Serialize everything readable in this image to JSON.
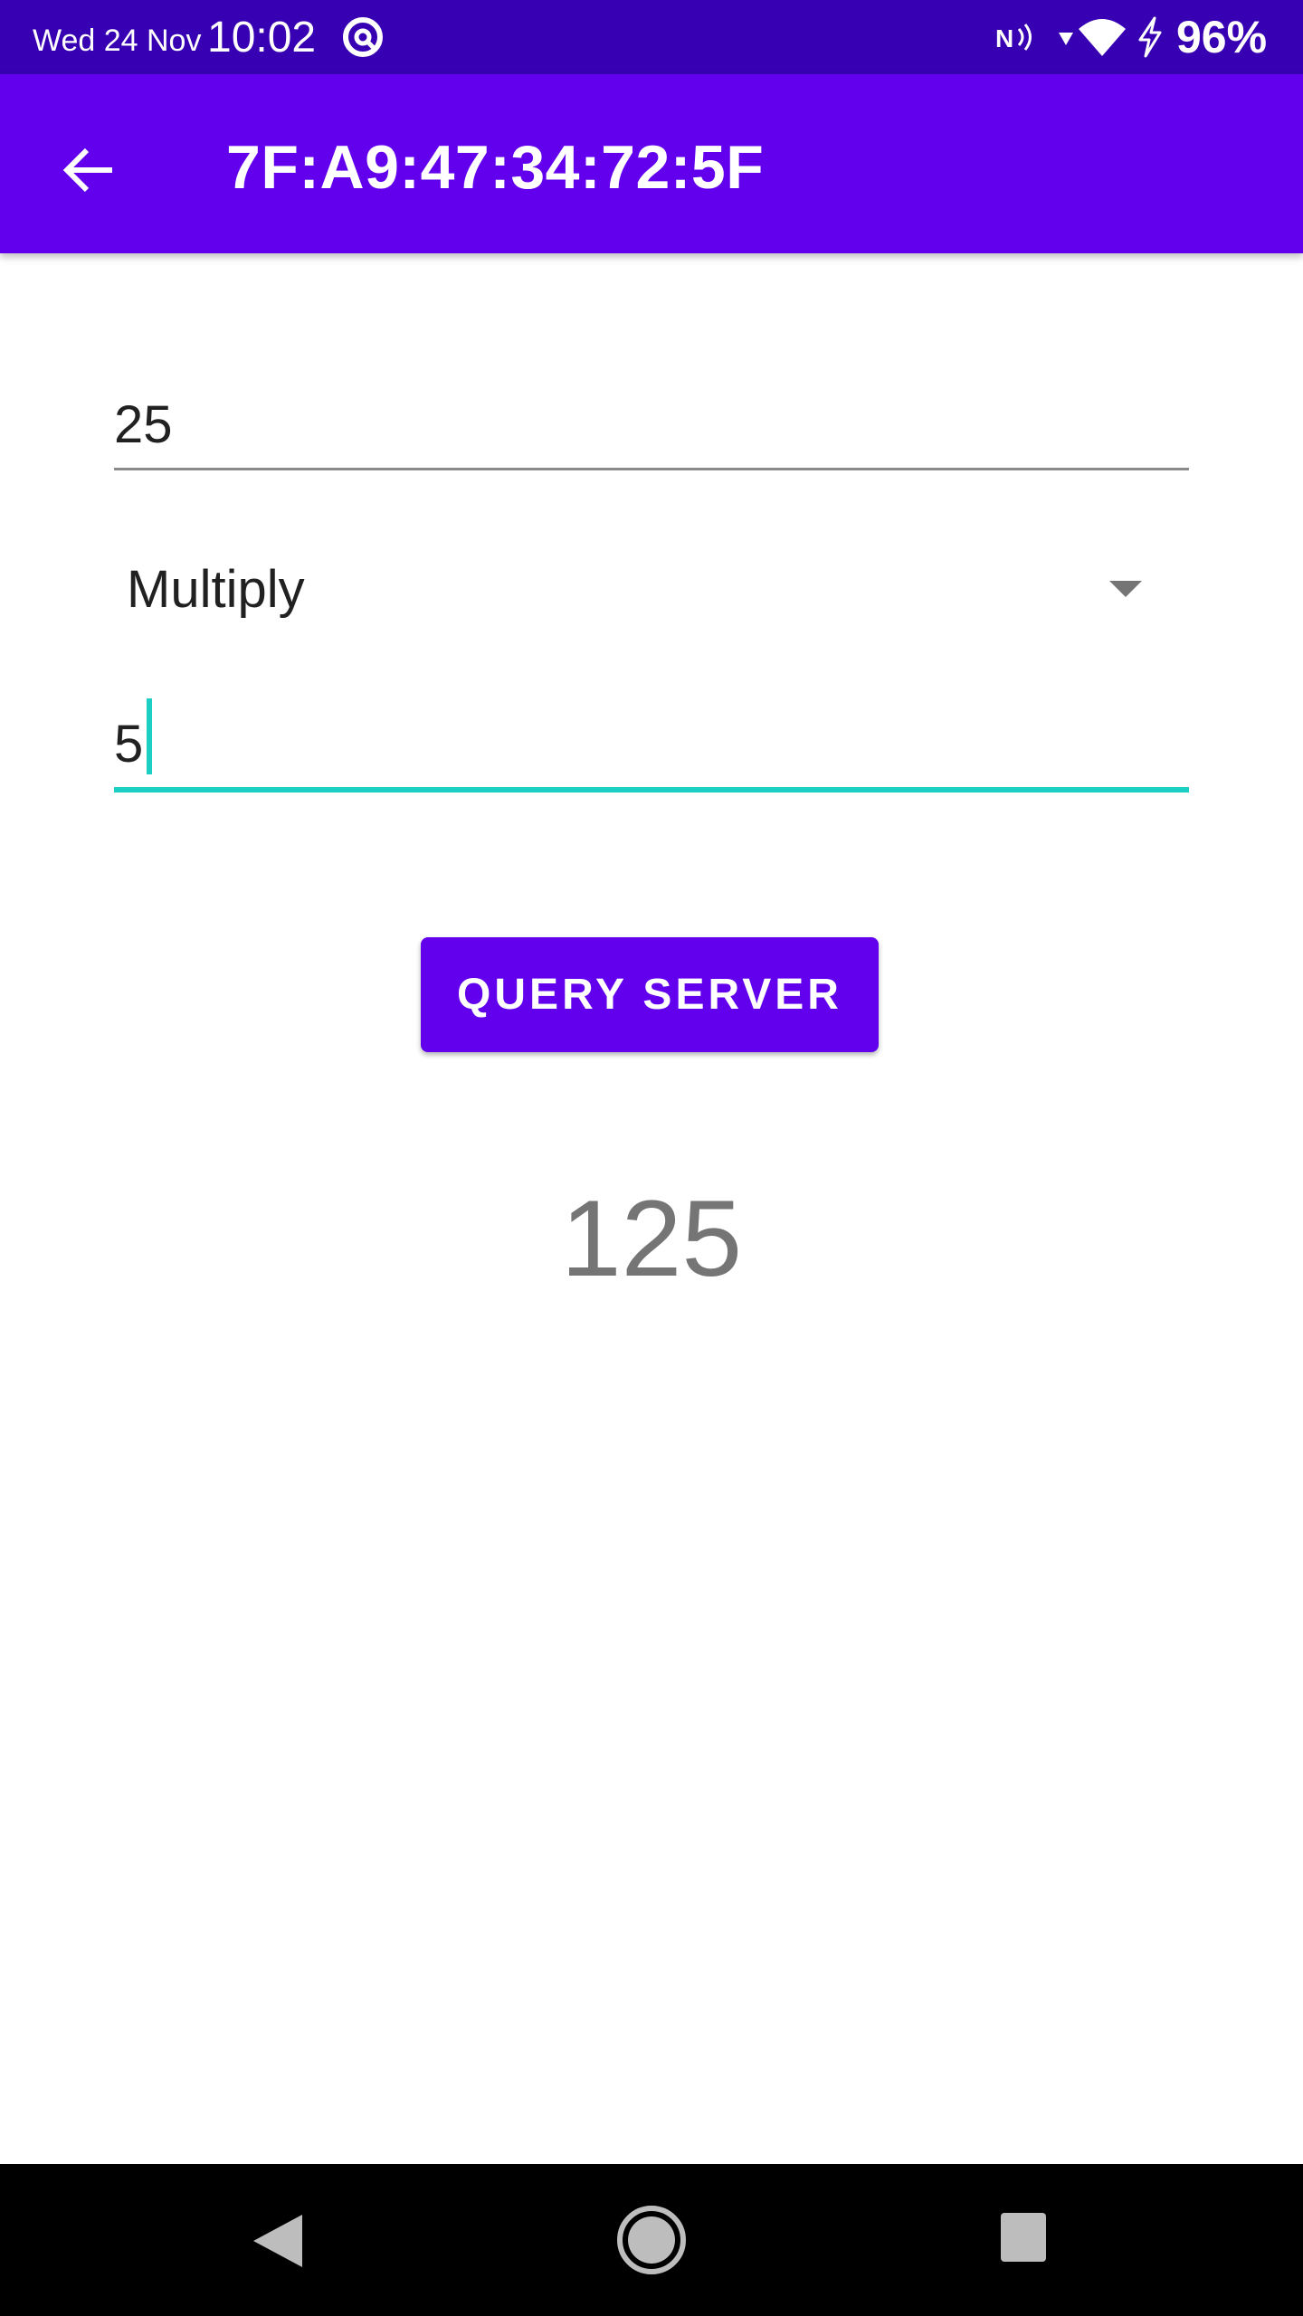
{
  "status_bar": {
    "date": "Wed 24 Nov",
    "time": "10:02",
    "battery": "96%",
    "icons": [
      "app-notification-icon",
      "nfc-icon",
      "signal-arrow-icon",
      "wifi-icon",
      "charging-icon"
    ]
  },
  "app_bar": {
    "title": "7F:A9:47:34:72:5F",
    "back_icon": "arrow-back-icon"
  },
  "form": {
    "first_value": "25",
    "operation": "Multiply",
    "operation_icon": "dropdown-arrow-icon",
    "second_value": "5"
  },
  "button": {
    "label": "QUERY SERVER"
  },
  "result": {
    "value": "125"
  },
  "nav_bar": {
    "icons": [
      "nav-back-icon",
      "nav-home-icon",
      "nav-recents-icon"
    ]
  },
  "colors": {
    "status_bar": "#3700b3",
    "primary": "#6200ee",
    "accent": "#1ccfc5",
    "result_text": "#757575"
  }
}
